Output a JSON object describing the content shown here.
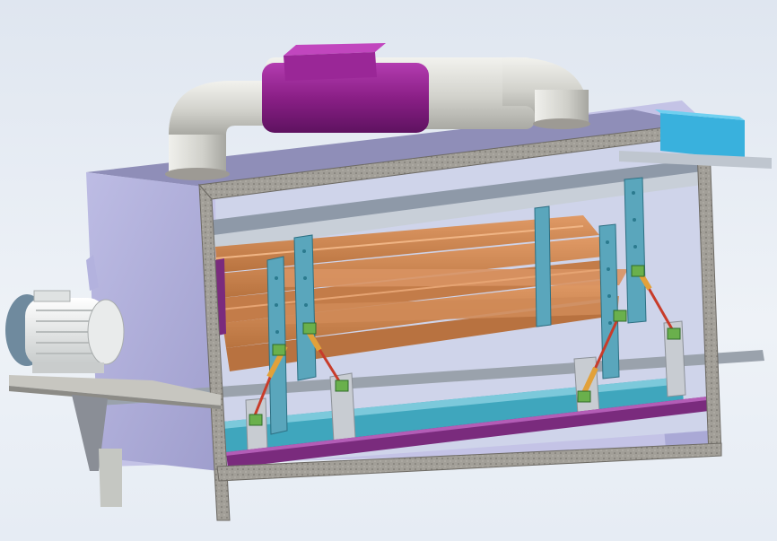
{
  "viewport": {
    "background_top": "#dfe6f0",
    "background_bottom": "#e6ecf4"
  },
  "model": {
    "components": [
      "exhaust-duct",
      "duct-inlet-box",
      "housing-box",
      "front-frame",
      "top-rail",
      "bottom-rail",
      "electric-motor",
      "motor-mount-plate",
      "support-leg",
      "wooden-slats",
      "vertical-slotted-brackets",
      "actuator-rods",
      "cyan-channel",
      "purple-rail",
      "blue-end-cap",
      "drive-shaft"
    ],
    "colors": {
      "housing": "#b3b2de",
      "housing_dark": "#9c9bca",
      "frame": "#9c9a94",
      "duct": "#d6d6d0",
      "duct_collar": "#8a1f86",
      "duct_box": "#9a2797",
      "wood": "#c98452",
      "wood_dark": "#a96a3f",
      "bracket": "#5aa6bc",
      "actuator": "#c83c2a",
      "channel": "#3fa6bd",
      "rail_purple": "#7a2b7d",
      "end_cap": "#39b1dd",
      "motor": "#e4e6e6"
    }
  }
}
